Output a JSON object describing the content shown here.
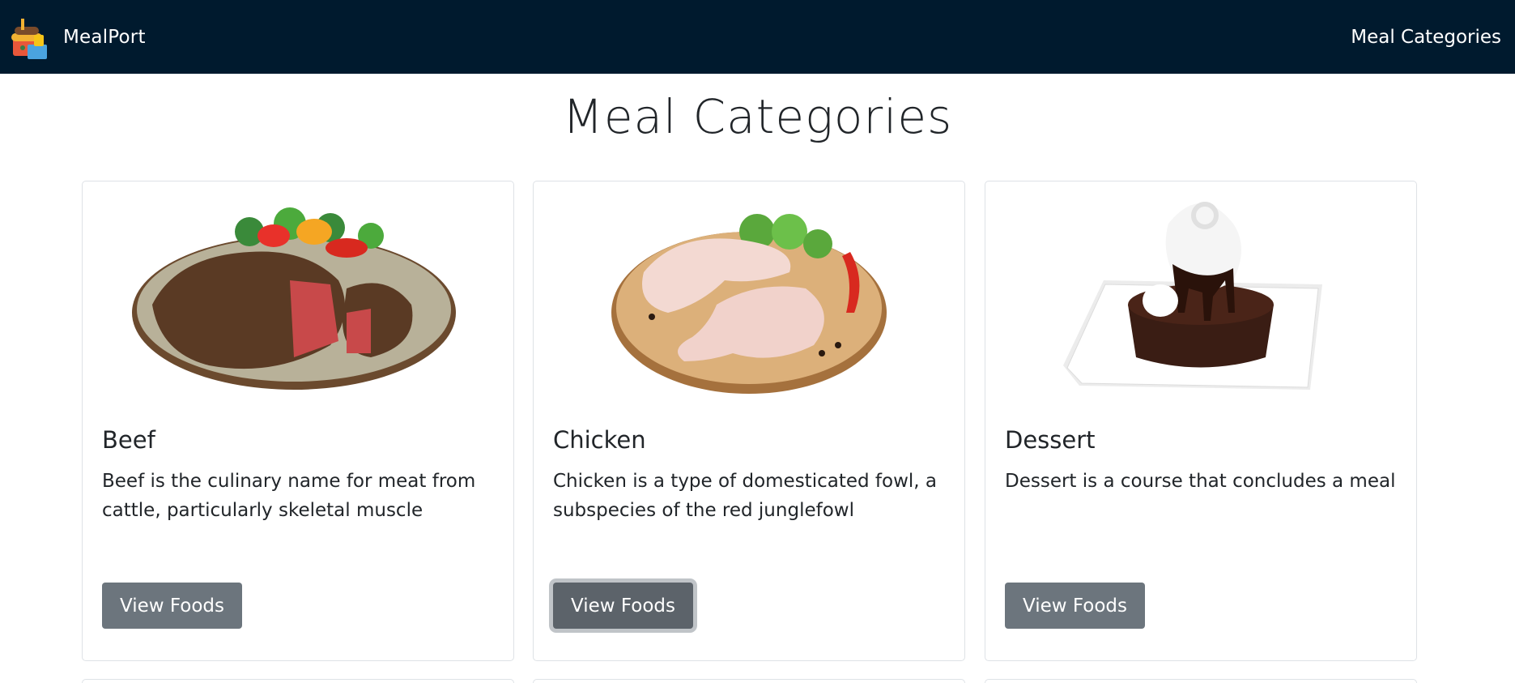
{
  "navbar": {
    "brand": "MealPort",
    "link": "Meal Categories"
  },
  "page": {
    "title": "Meal Categories"
  },
  "categories": [
    {
      "name": "Beef",
      "description": "Beef is the culinary name for meat from cattle, particularly skeletal muscle",
      "button": "View Foods",
      "icon": "beef-steak-image"
    },
    {
      "name": "Chicken",
      "description": "Chicken is a type of domesticated fowl, a subspecies of the red junglefowl",
      "button": "View Foods",
      "icon": "chicken-legs-image"
    },
    {
      "name": "Dessert",
      "description": "Dessert is a course that concludes a meal",
      "button": "View Foods",
      "icon": "chocolate-cake-image"
    }
  ],
  "colors": {
    "navbar_bg": "#001a2e",
    "button_bg": "#6c757d"
  }
}
